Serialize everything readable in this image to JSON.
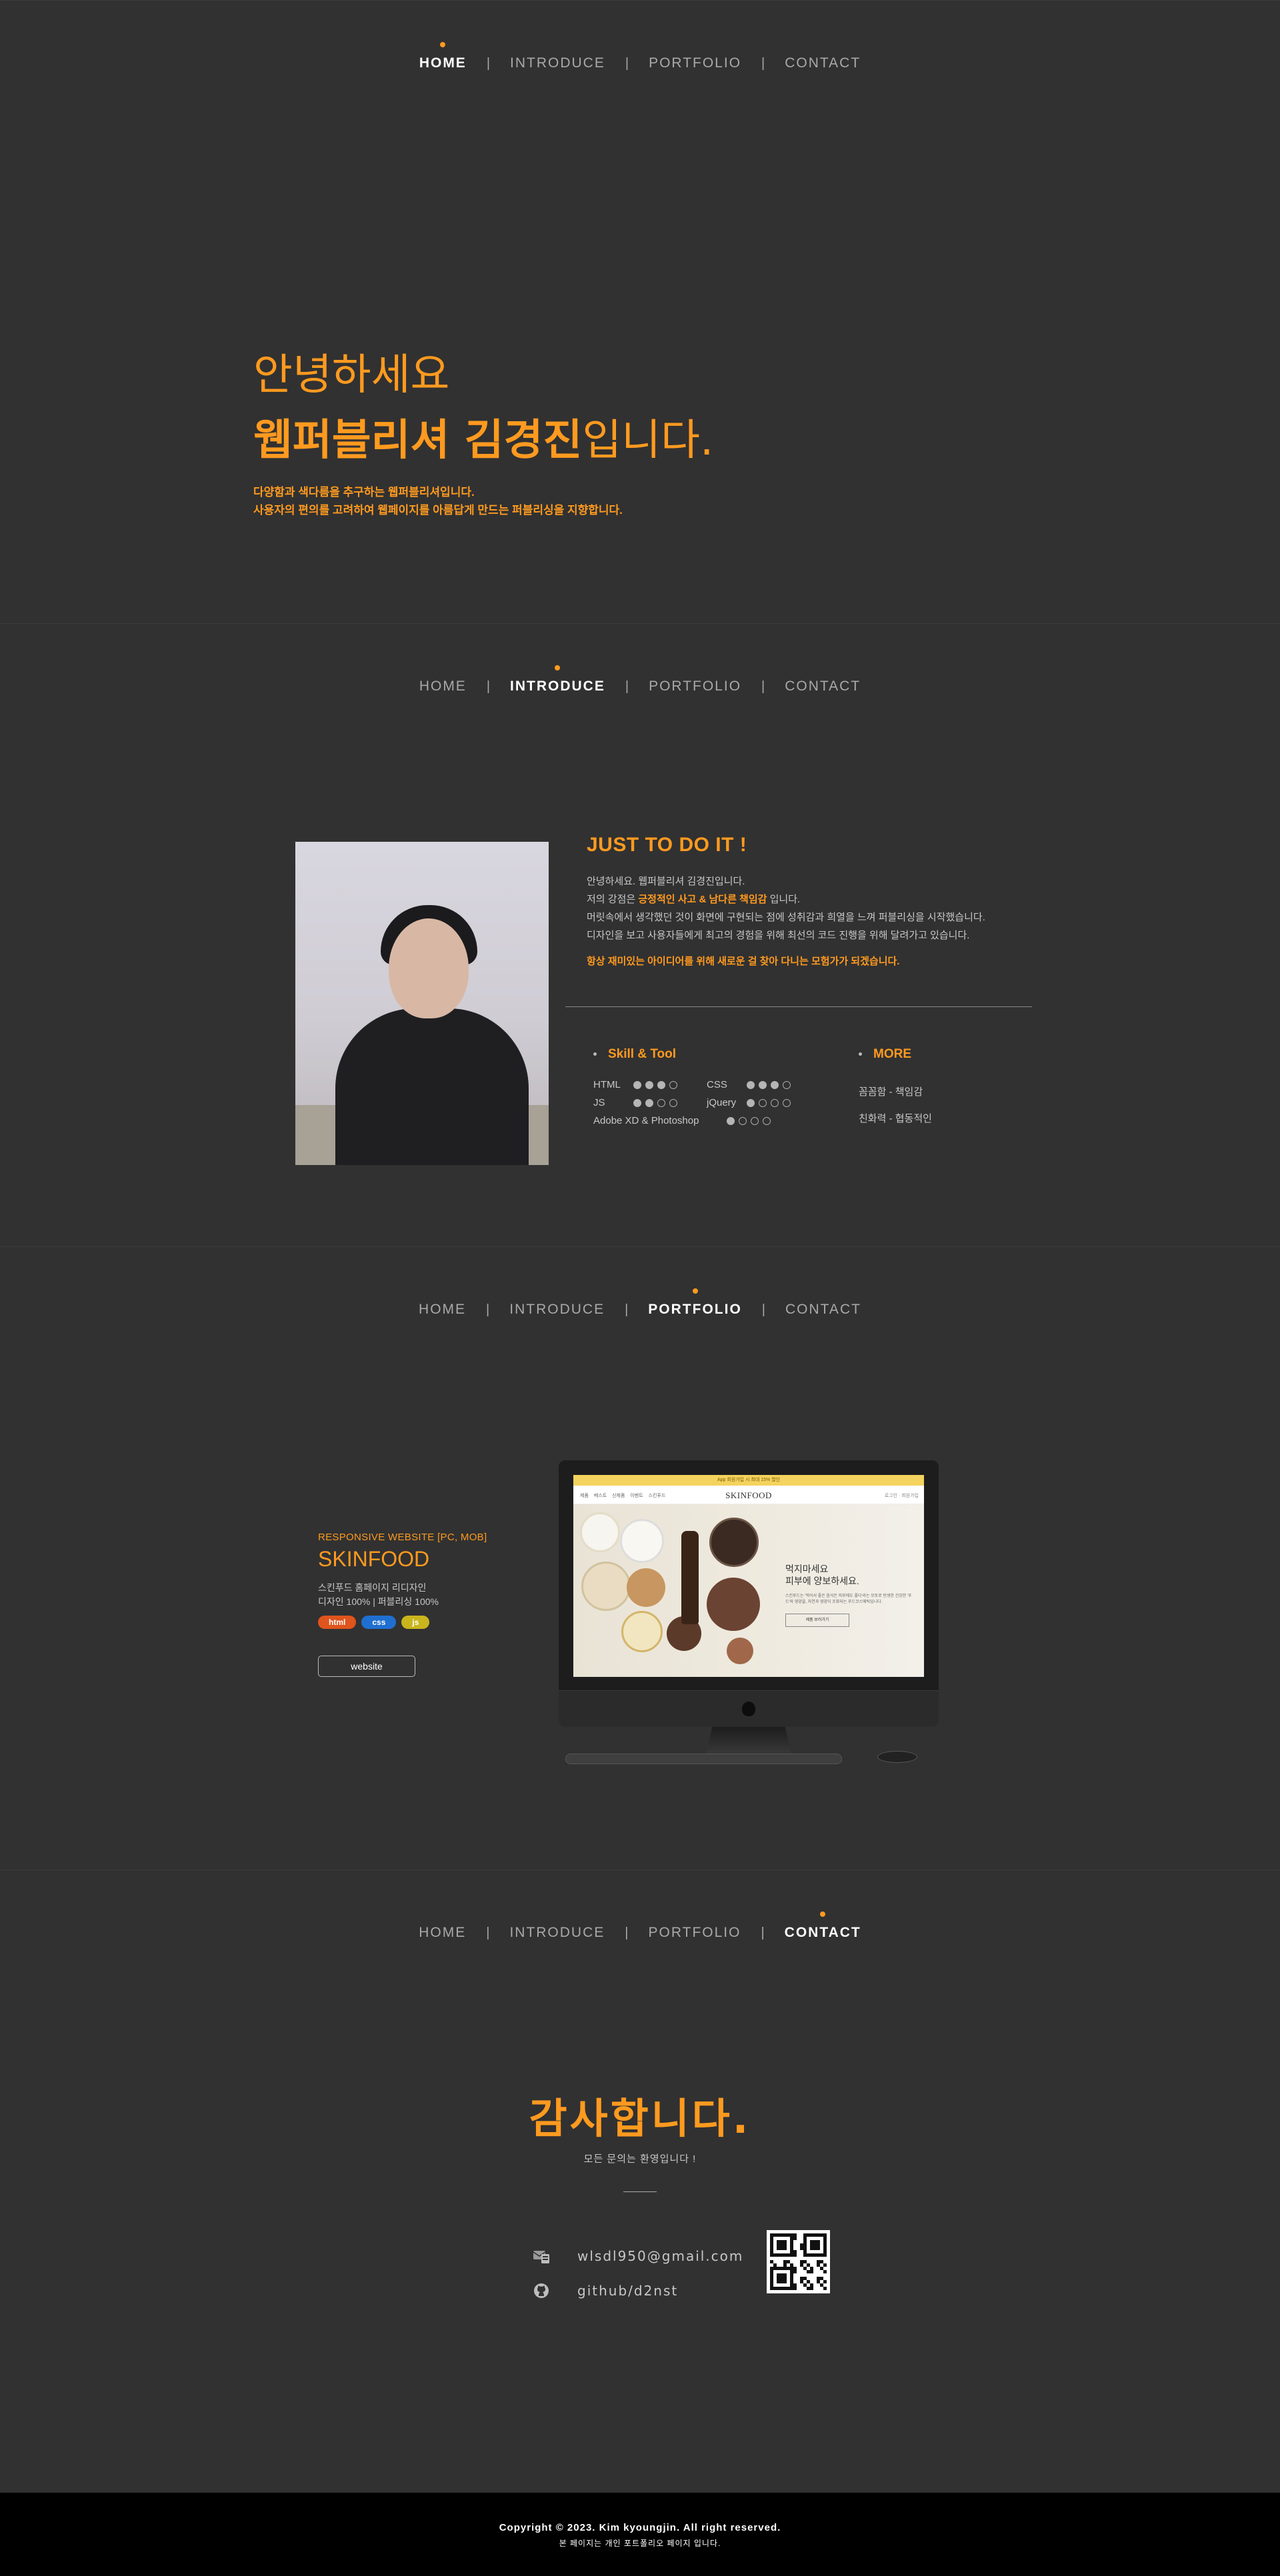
{
  "nav": {
    "items": [
      "HOME",
      "INTRODUCE",
      "PORTFOLIO",
      "CONTACT"
    ]
  },
  "home": {
    "line1": "안녕하세요",
    "line2_bold": "웹퍼블리셔 김경진",
    "line2_rest": "입니다.",
    "desc1": "다양함과 색다름을 추구하는 웹퍼블리셔입니다.",
    "desc2": "사용자의 편의를 고려하여 웹페이지를 아름답게 만드는 퍼블리싱을 지향합니다."
  },
  "intro": {
    "heading": "JUST TO DO IT !",
    "p1": "안녕하세요. 웹퍼블리셔 김경진입니다.",
    "p2_pre": "저의 강점은 ",
    "p2_hl": "긍정적인 사고 & 남다른 책임감",
    "p2_post": " 입니다.",
    "p3": "머릿속에서 생각했던 것이 화면에 구현되는 점에 성취감과 희열을 느껴 퍼블리싱을 시작했습니다.",
    "p4": "디자인을 보고 사용자들에게 최고의  경험을 위해 최선의 코드 진행을 위해 달려가고 있습니다.",
    "note": "항상 재미있는 아이디어를 위해 새로운 걸 찾아 다니는 모험가가 되겠습니다.",
    "skills_title": "Skill & Tool",
    "skills": [
      {
        "name": "HTML",
        "level": 3
      },
      {
        "name": "CSS",
        "level": 3
      },
      {
        "name": "JS",
        "level": 2
      },
      {
        "name": "jQuery",
        "level": 1
      },
      {
        "name": "Adobe XD & Photoshop",
        "level": 1
      }
    ],
    "more_title": "MORE",
    "more": [
      "꼼꼼함 - 책임감",
      "친화력 - 협동적인"
    ]
  },
  "portfolio": {
    "kind": "RESPONSIVE WEBSITE [PC, MOB]",
    "title": "SKINFOOD",
    "desc1": "스킨푸드 홈페이지 리디자인",
    "desc2": "디자인 100% | 퍼블리싱 100%",
    "tags": [
      {
        "label": "html",
        "color": "#e0541d"
      },
      {
        "label": "css",
        "color": "#1f6fd1"
      },
      {
        "label": "js",
        "color": "#c9b51d"
      }
    ],
    "button": "website",
    "screen": {
      "topbar": "App 회원가입 시 최대 15% 할인",
      "logo": "SKINFOOD",
      "menu": "제품 베스트 신제품 이벤트 스킨푸드",
      "util": "로그인 · 회원가입",
      "banner_title1": "먹지마세요",
      "banner_title2": "피부에 양보하세요.",
      "banner_desc": "스킨푸드는 '먹어서 좋은 음식은 피부에도 좋다'라는 모토로 탄생한 건강한 '푸드'와 영양을, 자연과 영양이 조화되는 푸드코스메틱입니다.",
      "banner_btn": "제품 보러가기"
    }
  },
  "contact": {
    "title": "감사합니다.",
    "subtitle": "모든 문의는 환영입니다 !",
    "email": "wlsdl950@gmail.com",
    "github": "github/d2nst"
  },
  "footer": {
    "copyright": "Copyright © 2023. Kim kyoungjin. All right reserved.",
    "notice": "본 페이지는 개인 포트폴리오 페이지 입니다."
  },
  "colors": {
    "accent": "#ff9a1f",
    "background": "#313131",
    "footer": "#000000"
  }
}
